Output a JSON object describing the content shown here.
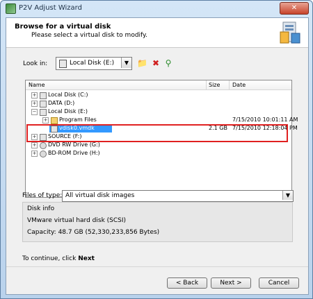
{
  "window": {
    "title": "P2V Adjust Wizard",
    "close_glyph": "✕"
  },
  "header": {
    "title": "Browse for a virtual disk",
    "subtitle": "Please select a virtual disk to modify."
  },
  "lookin": {
    "label": "Look in:",
    "value": "Local Disk (E:)"
  },
  "toolbar": {
    "new_folder_icon": "folder-add-icon",
    "delete_icon": "delete-icon",
    "network_icon": "network-drive-icon"
  },
  "tree": {
    "columns": {
      "name": "Name",
      "size": "Size",
      "date": "Date"
    },
    "rows": [
      {
        "label": "Local Disk (C:)",
        "size": "",
        "date": "",
        "expander": "+",
        "indent": 0,
        "icon": "drive"
      },
      {
        "label": "DATA (D:)",
        "size": "",
        "date": "",
        "expander": "+",
        "indent": 0,
        "icon": "drive"
      },
      {
        "label": "Local Disk (E:)",
        "size": "",
        "date": "",
        "expander": "−",
        "indent": 0,
        "icon": "drive"
      },
      {
        "label": "Program Files",
        "size": "",
        "date": "7/15/2010 10:01:11 AM",
        "expander": "+",
        "indent": 1,
        "icon": "folder"
      },
      {
        "label": "vdisk0.vmdk",
        "size": "2.1 GB",
        "date": "7/15/2010 12:18:04 PM",
        "expander": "",
        "indent": 1,
        "icon": "disk",
        "selected": true
      },
      {
        "label": "SOURCE (F:)",
        "size": "",
        "date": "",
        "expander": "+",
        "indent": 0,
        "icon": "drive"
      },
      {
        "label": "DVD RW Drive (G:)",
        "size": "",
        "date": "",
        "expander": "+",
        "indent": 0,
        "icon": "optical"
      },
      {
        "label": "BD-ROM Drive (H:)",
        "size": "",
        "date": "",
        "expander": "+",
        "indent": 0,
        "icon": "optical"
      }
    ]
  },
  "filetype": {
    "label": "Files of type:",
    "value": "All virtual disk images"
  },
  "diskinfo": {
    "title": "Disk info",
    "type": "VMware virtual hard disk (SCSI)",
    "capacity": "Capacity:  48.7 GB (52,330,233,856 Bytes)"
  },
  "continue": {
    "prefix": "To continue, click",
    "action": "Next"
  },
  "buttons": {
    "back": "< Back",
    "next": "Next >",
    "cancel": "Cancel"
  },
  "colors": {
    "selection": "#3399ff",
    "highlight": "#e02020"
  }
}
